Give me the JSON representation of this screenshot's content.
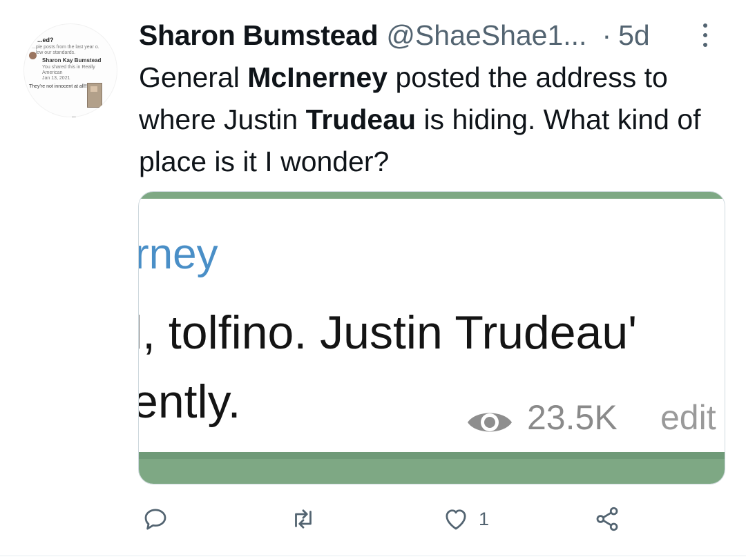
{
  "tweet": {
    "display_name": "Sharon Bumstead",
    "handle": "@ShaeShae1...",
    "separator": "·",
    "time": "5d",
    "text_segments": [
      "General ",
      "McInerney",
      " posted the address to where Justin ",
      "Trudeau",
      " is hiding. What kind of place is it I wonder?"
    ]
  },
  "avatar": {
    "title": "...ed?",
    "line1": "...ple posts from the last year o.",
    "line2": "...low our standards.",
    "name": "Sharon Kay Bumstead",
    "line3": "You shared this in Really",
    "line4": "American",
    "date": "Jan 13, 2021",
    "line5": "They're not innocent at all!!"
  },
  "media": {
    "name_fragment": "rney",
    "line1": "l, tolfino. Justin Trudeau'",
    "line2": "ently.",
    "views": "23.5K",
    "edit": "edit"
  },
  "actions": {
    "reply_count": "",
    "retweet_count": "",
    "like_count": "1"
  },
  "colors": {
    "text": "#0f1419",
    "secondary": "#536471",
    "link_blue": "#4a8fc7",
    "telegram_green": "#7ea884"
  },
  "icons": [
    "avatar",
    "more-dots-icon",
    "eye-icon",
    "reply-icon",
    "retweet-icon",
    "like-icon",
    "share-icon"
  ]
}
